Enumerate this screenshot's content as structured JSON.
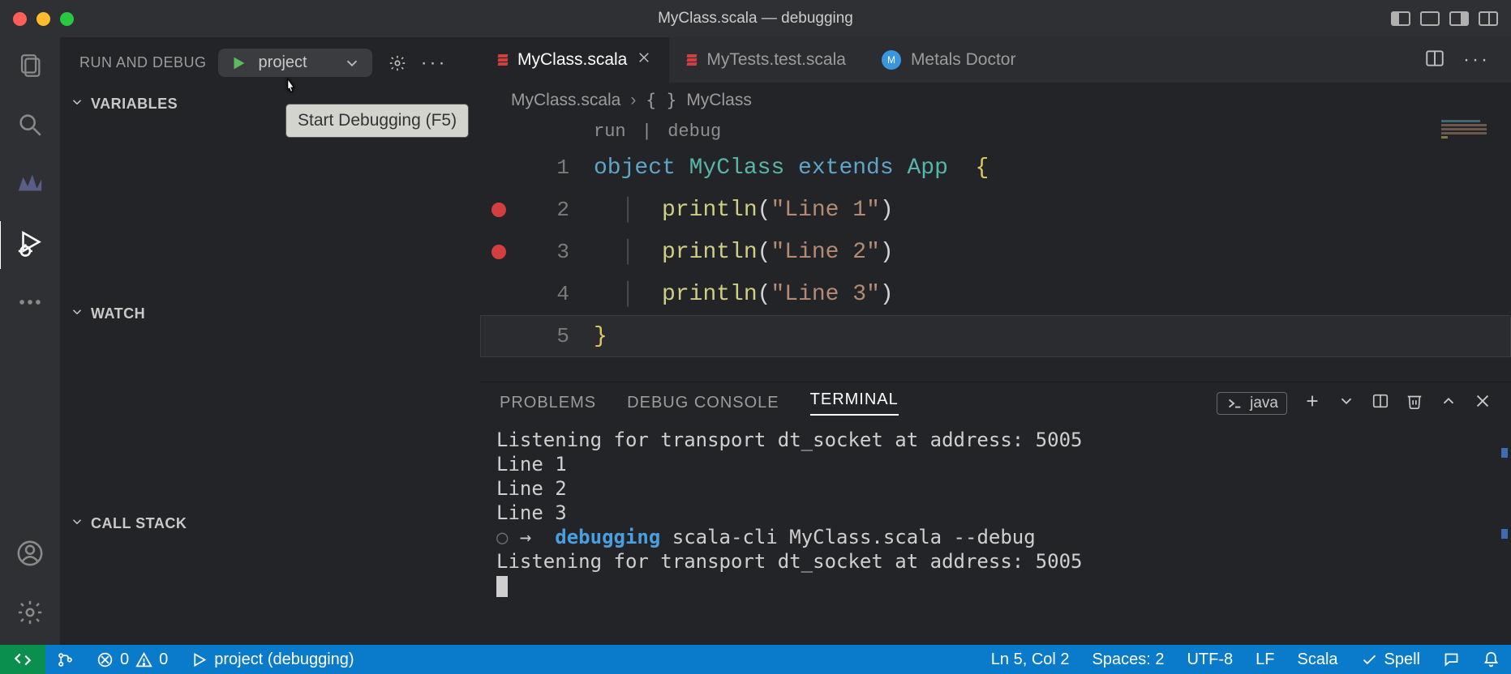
{
  "window": {
    "title": "MyClass.scala — debugging"
  },
  "sidebar": {
    "title": "RUN AND DEBUG",
    "run_config": "project",
    "tooltip": "Start Debugging (F5)",
    "sections": {
      "variables": "VARIABLES",
      "watch": "WATCH",
      "callstack": "CALL STACK"
    }
  },
  "tabs": [
    {
      "label": "MyClass.scala",
      "active": true,
      "closable": true,
      "icon": "scala"
    },
    {
      "label": "MyTests.test.scala",
      "active": false,
      "closable": false,
      "icon": "scala"
    },
    {
      "label": "Metals Doctor",
      "active": false,
      "closable": false,
      "icon": "metals"
    }
  ],
  "breadcrumb": {
    "file": "MyClass.scala",
    "symbol": "MyClass"
  },
  "codelens": {
    "run": "run",
    "debug": "debug"
  },
  "code": [
    {
      "num": 1,
      "bp": false,
      "tokens": [
        [
          "kw",
          "object "
        ],
        [
          "cls",
          "MyClass "
        ],
        [
          "kw",
          "extends "
        ],
        [
          "cls",
          "App  "
        ],
        [
          "brace",
          "{"
        ]
      ]
    },
    {
      "num": 2,
      "bp": true,
      "tokens": [
        [
          "indent",
          "  "
        ],
        [
          "guide",
          "|"
        ],
        [
          "pad",
          "  "
        ],
        [
          "fn",
          "println"
        ],
        [
          "punc",
          "("
        ],
        [
          "str",
          "\"Line 1\""
        ],
        [
          "punc",
          ")"
        ]
      ]
    },
    {
      "num": 3,
      "bp": true,
      "tokens": [
        [
          "indent",
          "  "
        ],
        [
          "guide",
          "|"
        ],
        [
          "pad",
          "  "
        ],
        [
          "fn",
          "println"
        ],
        [
          "punc",
          "("
        ],
        [
          "str",
          "\"Line 2\""
        ],
        [
          "punc",
          ")"
        ]
      ]
    },
    {
      "num": 4,
      "bp": false,
      "tokens": [
        [
          "indent",
          "  "
        ],
        [
          "guide",
          "|"
        ],
        [
          "pad",
          "  "
        ],
        [
          "fn",
          "println"
        ],
        [
          "punc",
          "("
        ],
        [
          "str",
          "\"Line 3\""
        ],
        [
          "punc",
          ")"
        ]
      ]
    },
    {
      "num": 5,
      "bp": false,
      "current": true,
      "tokens": [
        [
          "brace",
          "}"
        ]
      ]
    }
  ],
  "panel": {
    "tabs": {
      "problems": "PROBLEMS",
      "debug_console": "DEBUG CONSOLE",
      "terminal": "TERMINAL"
    },
    "terminal_name": "java",
    "lines": [
      "Listening for transport dt_socket at address: 5005",
      "Line 1",
      "Line 2",
      "Line 3"
    ],
    "prompt": {
      "circle": "○",
      "arrow": "→",
      "dir": "debugging",
      "cmd": "scala-cli MyClass.scala --debug"
    },
    "lines2": [
      "Listening for transport dt_socket at address: 5005"
    ]
  },
  "status": {
    "branch": "",
    "errors": "0",
    "warnings": "0",
    "launch": "project (debugging)",
    "ln_col": "Ln 5, Col 2",
    "spaces": "Spaces: 2",
    "encoding": "UTF-8",
    "eol": "LF",
    "lang": "Scala",
    "spell": "Spell"
  }
}
